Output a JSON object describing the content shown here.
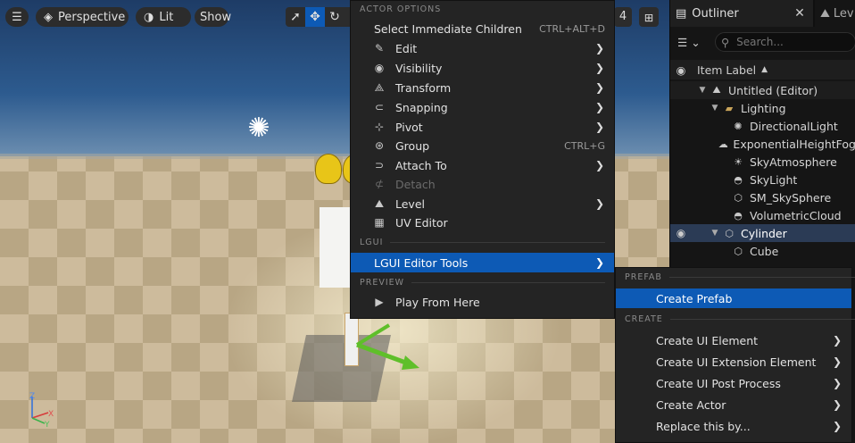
{
  "viewport": {
    "view_mode": "Perspective",
    "lighting_mode": "Lit",
    "show_label": "Show",
    "camera_speed": "4",
    "axis": {
      "z": "Z",
      "x": "X",
      "y": "Y"
    }
  },
  "outliner": {
    "tab_label": "Outliner",
    "close_glyph": "✕",
    "levels_tab_label": "Lev",
    "search_placeholder": "Search...",
    "column_label": "Item Label",
    "sort_glyph": "▲",
    "rows": [
      {
        "label": "Untitled (Editor)",
        "icon": "level-icon",
        "glyph": "⛰"
      },
      {
        "label": "Lighting",
        "icon": "folder-icon",
        "glyph": "▬"
      },
      {
        "label": "DirectionalLight",
        "icon": "directional-light-icon",
        "glyph": "✺"
      },
      {
        "label": "ExponentialHeightFog",
        "icon": "fog-icon",
        "glyph": "☁"
      },
      {
        "label": "SkyAtmosphere",
        "icon": "sky-atmosphere-icon",
        "glyph": "☀"
      },
      {
        "label": "SkyLight",
        "icon": "sky-light-icon",
        "glyph": "◓"
      },
      {
        "label": "SM_SkySphere",
        "icon": "static-mesh-icon",
        "glyph": "⬡"
      },
      {
        "label": "VolumetricCloud",
        "icon": "volumetric-cloud-icon",
        "glyph": "◓"
      },
      {
        "label": "Cylinder",
        "icon": "static-mesh-icon",
        "glyph": "⬡"
      },
      {
        "label": "Cube",
        "icon": "static-mesh-icon",
        "glyph": "⬡"
      }
    ]
  },
  "context_menu": {
    "section_actor_options": "ACTOR OPTIONS",
    "section_lgui": "LGUI",
    "section_preview": "PREVIEW",
    "items": [
      {
        "label": "Select Immediate Children",
        "shortcut": "CTRL+ALT+D",
        "icon": "",
        "glyph": ""
      },
      {
        "label": "Edit",
        "icon": "edit-icon",
        "glyph": "✎"
      },
      {
        "label": "Visibility",
        "icon": "eye-icon",
        "glyph": "◉"
      },
      {
        "label": "Transform",
        "icon": "transform-icon",
        "glyph": "⟁"
      },
      {
        "label": "Snapping",
        "icon": "magnet-icon",
        "glyph": "⊂"
      },
      {
        "label": "Pivot",
        "icon": "pivot-icon",
        "glyph": "⊹"
      },
      {
        "label": "Group",
        "shortcut": "CTRL+G",
        "icon": "group-icon",
        "glyph": "⊛"
      },
      {
        "label": "Attach To",
        "icon": "attach-icon",
        "glyph": "⊃"
      },
      {
        "label": "Detach",
        "icon": "detach-icon",
        "glyph": "⊄"
      },
      {
        "label": "Level",
        "icon": "level-icon",
        "glyph": "⛰"
      },
      {
        "label": "UV Editor",
        "icon": "uv-grid-icon",
        "glyph": "▦"
      }
    ],
    "lgui_item": "LGUI Editor Tools",
    "play_item": "Play From Here",
    "arrow_glyph": "❯",
    "play_glyph": "▶"
  },
  "submenu": {
    "section_prefab": "PREFAB",
    "section_create": "CREATE",
    "items": [
      "Create Prefab",
      "Create UI Element",
      "Create UI Extension Element",
      "Create UI Post Process",
      "Create Actor",
      "Replace this by..."
    ]
  },
  "colors": {
    "accent": "#0d5ab5",
    "menu_bg": "#242424",
    "outliner_bg": "#151515"
  }
}
